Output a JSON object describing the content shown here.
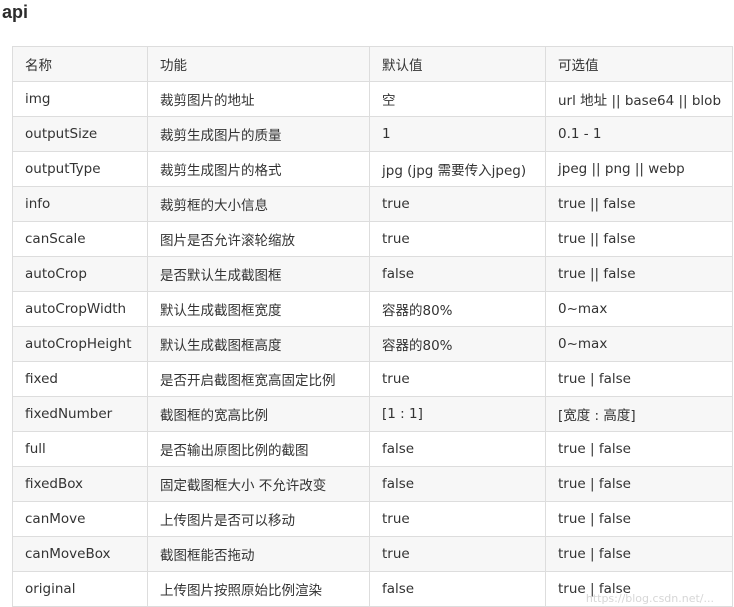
{
  "heading": "api",
  "table": {
    "headers": [
      "名称",
      "功能",
      "默认值",
      "可选值"
    ],
    "rows": [
      [
        "img",
        "裁剪图片的地址",
        "空",
        "url 地址 || base64 || blob"
      ],
      [
        "outputSize",
        "裁剪生成图片的质量",
        "1",
        "0.1 - 1"
      ],
      [
        "outputType",
        "裁剪生成图片的格式",
        "jpg (jpg 需要传入jpeg)",
        "jpeg || png || webp"
      ],
      [
        "info",
        "裁剪框的大小信息",
        "true",
        "true || false"
      ],
      [
        "canScale",
        "图片是否允许滚轮缩放",
        "true",
        "true || false"
      ],
      [
        "autoCrop",
        "是否默认生成截图框",
        "false",
        "true || false"
      ],
      [
        "autoCropWidth",
        "默认生成截图框宽度",
        "容器的80%",
        "0~max"
      ],
      [
        "autoCropHeight",
        "默认生成截图框高度",
        "容器的80%",
        "0~max"
      ],
      [
        "fixed",
        "是否开启截图框宽高固定比例",
        "true",
        "true | false"
      ],
      [
        "fixedNumber",
        "截图框的宽高比例",
        "[1 : 1]",
        "[宽度 : 高度]"
      ],
      [
        "full",
        "是否输出原图比例的截图",
        "false",
        "true | false"
      ],
      [
        "fixedBox",
        "固定截图框大小 不允许改变",
        "false",
        "true | false"
      ],
      [
        "canMove",
        "上传图片是否可以移动",
        "true",
        "true | false"
      ],
      [
        "canMoveBox",
        "截图框能否拖动",
        "true",
        "true | false"
      ],
      [
        "original",
        "上传图片按照原始比例渲染",
        "false",
        "true | false"
      ]
    ]
  },
  "watermark": "https://blog.csdn.net/..."
}
